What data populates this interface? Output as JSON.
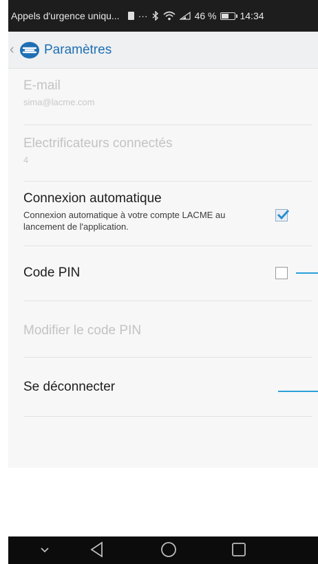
{
  "status_bar": {
    "text": "Appels d'urgence uniqu...",
    "dots": "···",
    "battery": "46 %",
    "time": "14:34"
  },
  "app_bar": {
    "title": "Paramètres"
  },
  "settings": {
    "email": {
      "title": "E-mail",
      "value": "sima@lacme.com"
    },
    "electrificateurs": {
      "title": "Electrificateurs connectés",
      "value": "4"
    },
    "auto_connect": {
      "title": "Connexion automatique",
      "description": "Connexion automatique à votre compte LACME au lancement de l'application.",
      "checked": true
    },
    "pin": {
      "title": "Code PIN",
      "checked": false
    },
    "modify_pin": {
      "title": "Modifier le code PIN"
    },
    "logout": {
      "title": "Se déconnecter"
    }
  },
  "colors": {
    "accent": "#1f6fb4",
    "callout": "#2aa0d8",
    "status_bar": "#1d1d1d",
    "nav_bar": "#0c0c0c"
  }
}
